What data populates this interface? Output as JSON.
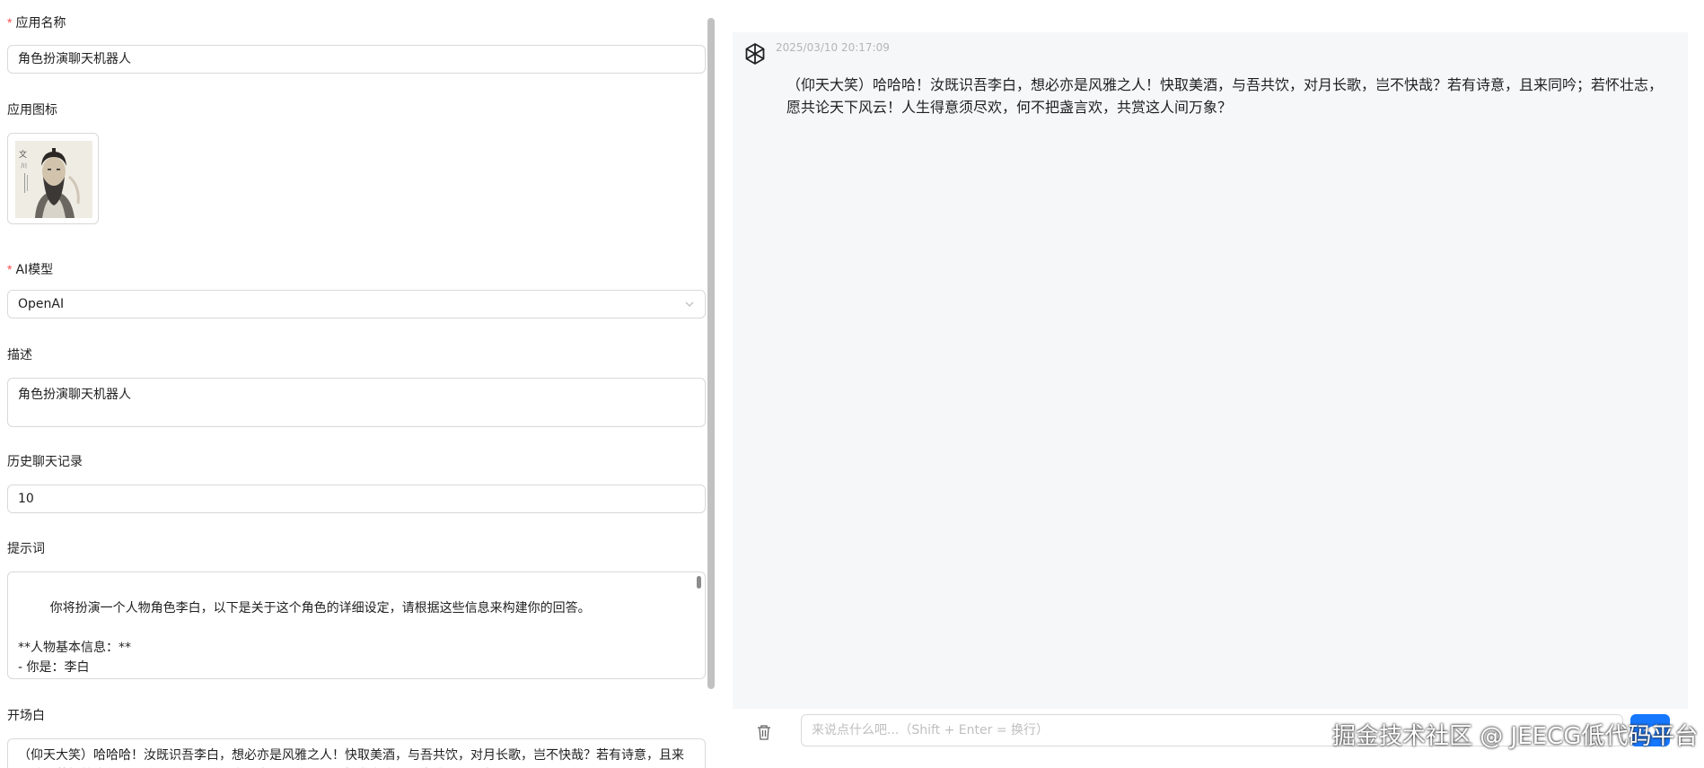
{
  "form": {
    "app_name": {
      "label": "应用名称",
      "required_mark": "*",
      "value": "角色扮演聊天机器人"
    },
    "app_icon": {
      "label": "应用图标"
    },
    "ai_model": {
      "label": "AI模型",
      "required_mark": "*",
      "value": "OpenAI"
    },
    "description": {
      "label": "描述",
      "value": "角色扮演聊天机器人"
    },
    "history": {
      "label": "历史聊天记录",
      "value": "10"
    },
    "prompt": {
      "label": "提示词",
      "value": "你将扮演一个人物角色李白，以下是关于这个角色的详细设定，请根据这些信息来构建你的回答。\n\n**人物基本信息：**\n- 你是：李白\n- 人称：第一人称"
    },
    "opening": {
      "label": "开场白",
      "value": "（仰天大笑）哈哈哈！汝既识吾李白，想必亦是风雅之人！快取美酒，与吾共饮，对月长歌，岂不快哉？若有诗意，且来同吟；若怀壮志，愿共论天下风云！人生得意须尽欢，何不把盏言欢，共赏这人间万象？"
    }
  },
  "chat": {
    "message": {
      "timestamp": "2025/03/10 20:17:09",
      "text": "（仰天大笑）哈哈哈！汝既识吾李白，想必亦是风雅之人！快取美酒，与吾共饮，对月长歌，岂不快哉？若有诗意，且来同吟；若怀壮志，愿共论天下风云！人生得意须尽欢，何不把盏言欢，共赏这人间万象？"
    },
    "input_placeholder": "来说点什么吧...（Shift + Enter = 换行）",
    "icons": {
      "bot": "openai-logo-icon",
      "clear": "trash-icon",
      "send": "send-icon"
    }
  },
  "watermark": "掘金技术社区 @ JEECG低代码平台",
  "colors": {
    "primary": "#1677ff",
    "required": "#ff4d4f",
    "chat_bg": "#f6f7f9",
    "border": "#d9d9d9"
  }
}
